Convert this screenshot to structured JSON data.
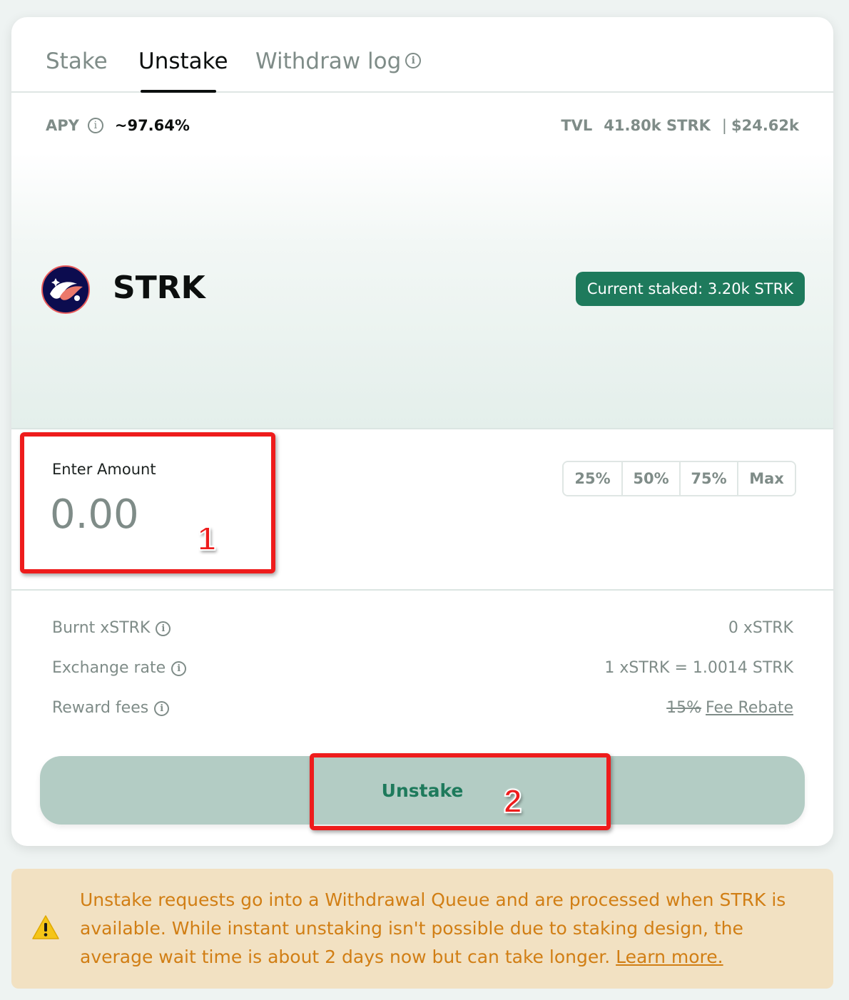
{
  "tabs": [
    {
      "label": "Stake"
    },
    {
      "label": "Unstake"
    },
    {
      "label": "Withdraw log"
    }
  ],
  "stats": {
    "apy_label": "APY",
    "apy_value": "~97.64%",
    "tvl_label": "TVL",
    "tvl_strk": "41.80k STRK",
    "tvl_usd": "$24.62k"
  },
  "token": {
    "name": "STRK",
    "current_staked": "Current staked: 3.20k STRK"
  },
  "amount": {
    "label": "Enter Amount",
    "placeholder": "0.00",
    "percent_buttons": [
      "25%",
      "50%",
      "75%",
      "Max"
    ]
  },
  "details": {
    "burnt_label": "Burnt xSTRK",
    "burnt_value": "0 xSTRK",
    "rate_label": "Exchange rate",
    "rate_value": "1 xSTRK = 1.0014 STRK",
    "fees_label": "Reward fees",
    "fees_old": "15%",
    "fees_link": "Fee Rebate"
  },
  "action": {
    "unstake_label": "Unstake"
  },
  "annotations": [
    "1",
    "2"
  ],
  "notice": {
    "text": "Unstake requests go into a Withdrawal Queue and are processed when STRK is available. While instant unstaking isn't possible due to staking design, the average wait time is about 2 days now but can take longer. ",
    "link": "Learn more."
  },
  "colors": {
    "accent": "#1e7a5c",
    "muted": "#7f8c88",
    "annotation": "#ee1c1c",
    "notice_bg": "#f2e1c2",
    "notice_text": "#d17e14"
  },
  "icons": [
    "info-icon",
    "strk-logo-icon",
    "warning-icon"
  ]
}
